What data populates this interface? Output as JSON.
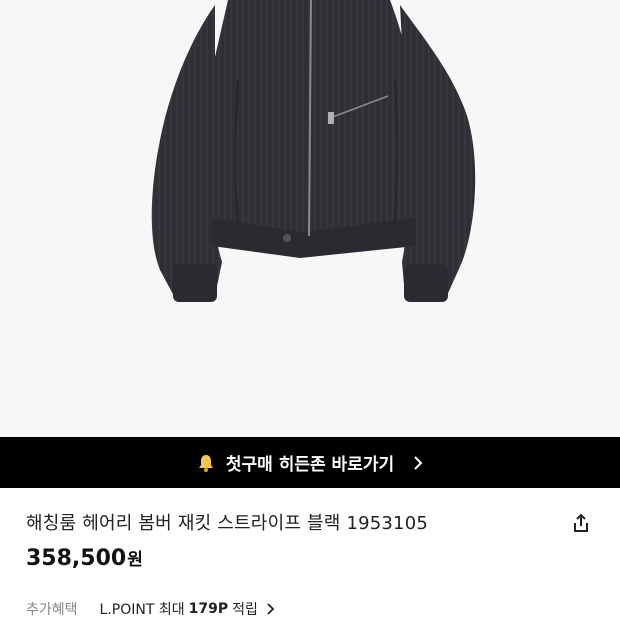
{
  "product_image": {
    "alt_icon": "bomber-jacket-image"
  },
  "banner": {
    "icon": "bell-icon",
    "text": "첫구매 히든존 바로가기",
    "chevron": "chevron-right-icon"
  },
  "product": {
    "title": "해칭룸 헤어리 봄버 재킷 스트라이프 블랙 1953105",
    "price": "358,500",
    "currency": "원"
  },
  "share": {
    "icon": "share-icon"
  },
  "benefits": {
    "label": "추가혜택",
    "prefix": "L.POINT 최대",
    "points": "179P",
    "suffix": "적립"
  },
  "colors": {
    "banner_bg": "#000000",
    "image_bg": "#f7f7f7",
    "jacket": "#2e2e33"
  }
}
